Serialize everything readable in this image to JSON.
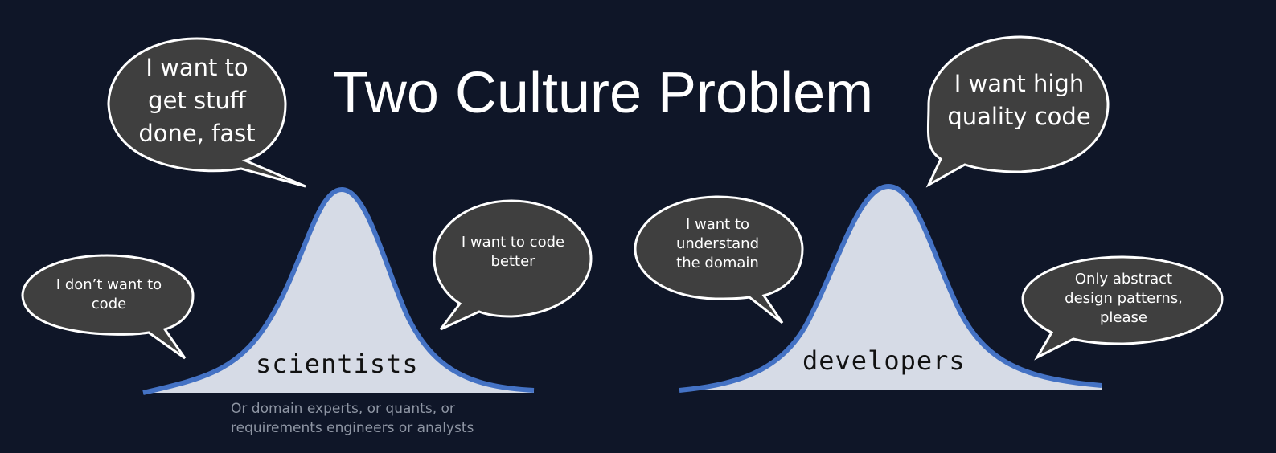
{
  "title": "Two Culture Problem",
  "bubbles": {
    "scientists_top": "I want to\nget stuff\ndone, fast",
    "scientists_left": "I don’t want to\ncode",
    "scientists_right": "I want to code\nbetter",
    "developers_top": "I want high\nquality code",
    "developers_left": "I want to\nunderstand\nthe domain",
    "developers_right": "Only abstract\ndesign patterns,\nplease"
  },
  "curves": {
    "left_label": "scientists",
    "right_label": "developers",
    "left_note": "Or domain experts, or quants, or\nrequirements engineers or analysts"
  },
  "colors": {
    "background": "#0f1628",
    "bubble_fill": "#3f3f3f",
    "bubble_outline": "#ffffff",
    "curve_stroke": "#4472c4",
    "curve_fill": "#d6dbe6"
  }
}
